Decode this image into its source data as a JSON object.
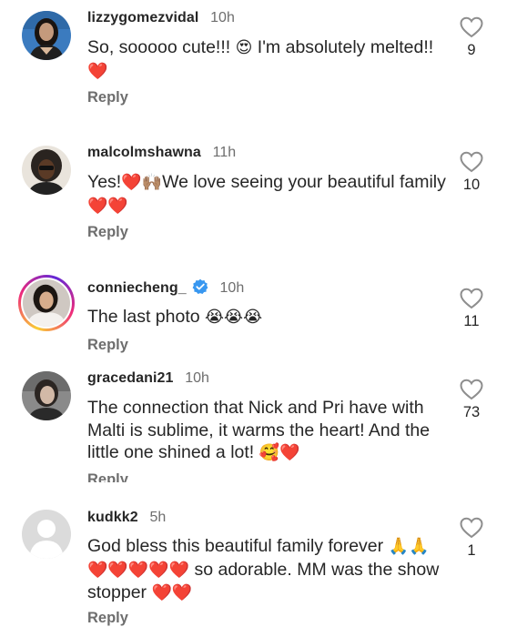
{
  "comments": [
    {
      "username": "lizzygomezvidal",
      "time": "10h",
      "text_parts": [
        "So, sooooo cute!!! ",
        "😍",
        " I'm absolutely melted!! ",
        "❤️"
      ],
      "reply": "Reply",
      "likes": "9"
    },
    {
      "username": "malcolmshawna",
      "time": "11h",
      "text_parts": [
        "Yes!",
        "❤️🙌🏽",
        "We love seeing your beautiful family ",
        "❤️❤️"
      ],
      "reply": "Reply",
      "likes": "10"
    },
    {
      "username": "conniecheng_",
      "time": "10h",
      "verified": true,
      "text_parts": [
        "The last photo ",
        "😭😭😭"
      ],
      "reply": "Reply",
      "likes": "11"
    },
    {
      "username": "gracedani21",
      "time": "10h",
      "text_parts": [
        "The connection that Nick and Pri have with Malti is sublime, it warms the heart!  And the little one shined a lot! ",
        "🥰❤️"
      ],
      "reply": "Reply",
      "likes": "73"
    },
    {
      "username": "kudkk2",
      "time": "5h",
      "text_parts": [
        "God bless this beautiful family forever ",
        "🙏🙏❤️❤️❤️❤️❤️",
        " so adorable.  MM was the show stopper ",
        "❤️❤️"
      ],
      "reply": "Reply",
      "likes": "1"
    }
  ],
  "colors": {
    "text": "#262626",
    "muted": "#6e6e6e",
    "heart": "#e8203a",
    "verified": "#3897f0"
  },
  "icons": {
    "like": "heart-outline-icon",
    "verified": "verified-badge-icon",
    "default_avatar": "default-avatar-icon"
  }
}
